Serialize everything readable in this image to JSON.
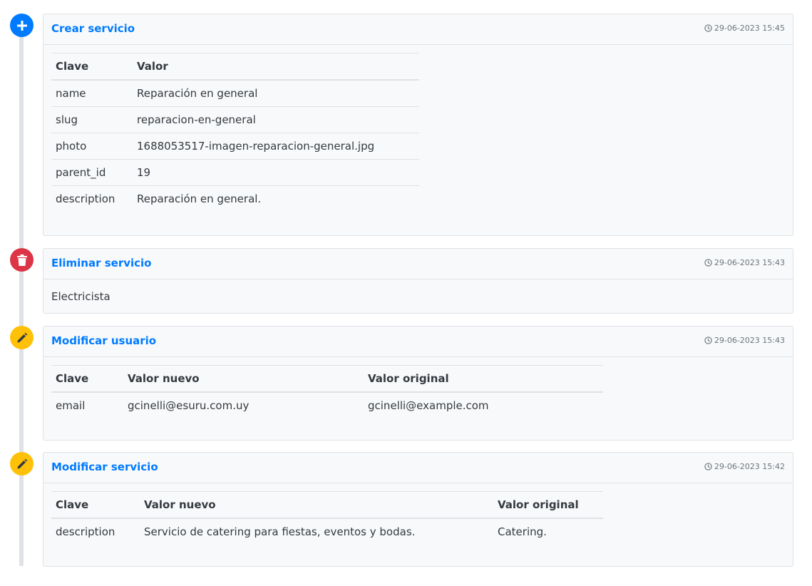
{
  "entries": [
    {
      "title": "Crear servicio",
      "time": "29-06-2023 15:45",
      "headers": [
        "Clave",
        "Valor"
      ],
      "rows": [
        [
          "name",
          "Reparación en general"
        ],
        [
          "slug",
          "reparacion-en-general"
        ],
        [
          "photo",
          "1688053517-imagen-reparacion-general.jpg"
        ],
        [
          "parent_id",
          "19"
        ],
        [
          "description",
          "Reparación en general."
        ]
      ]
    },
    {
      "title": "Eliminar servicio",
      "time": "29-06-2023 15:43",
      "text": "Electricista"
    },
    {
      "title": "Modificar usuario",
      "time": "29-06-2023 15:43",
      "headers": [
        "Clave",
        "Valor nuevo",
        "Valor original"
      ],
      "rows": [
        [
          "email",
          "gcinelli@esuru.com.uy",
          "gcinelli@example.com"
        ]
      ]
    },
    {
      "title": "Modificar servicio",
      "time": "29-06-2023 15:42",
      "headers": [
        "Clave",
        "Valor nuevo",
        "Valor original"
      ],
      "rows": [
        [
          "description",
          "Servicio de catering para fiestas, eventos y bodas.",
          "Catering."
        ]
      ]
    }
  ],
  "icons": {
    "create": "plus-icon",
    "delete": "trash-icon",
    "edit": "pencil-icon",
    "time": "clock-icon"
  },
  "colors": {
    "create": "#007bff",
    "delete": "#dc3545",
    "edit": "#ffc107",
    "title": "#007bff"
  }
}
